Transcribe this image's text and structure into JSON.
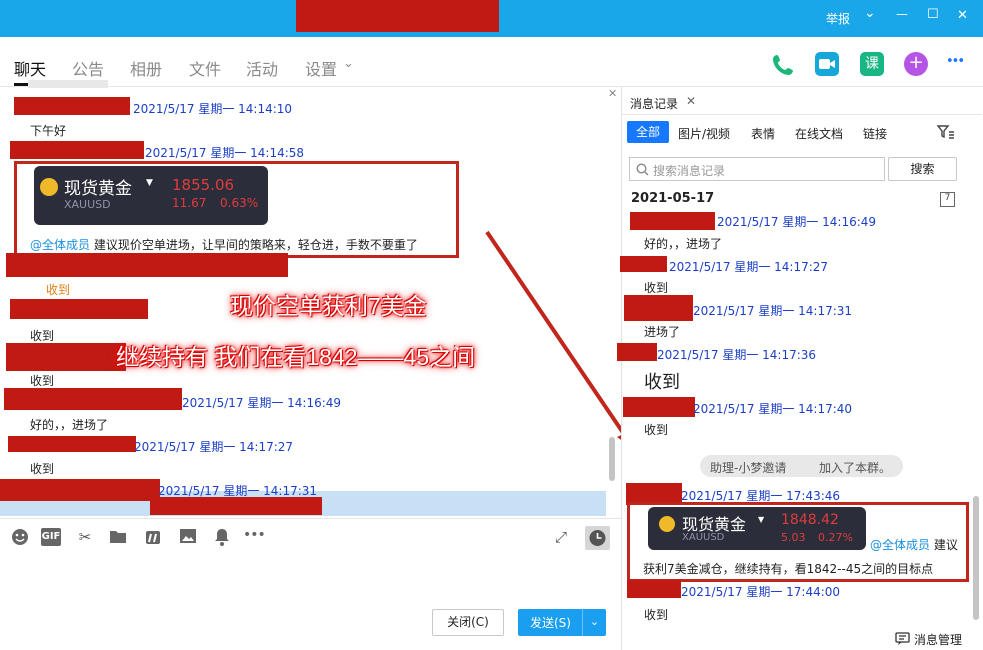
{
  "window": {
    "controls": {
      "report": "举报",
      "dropdown": "⌄",
      "minimize": "—",
      "maximize": "☐",
      "close": "✕"
    }
  },
  "nav": {
    "tabs": [
      "聊天",
      "公告",
      "相册",
      "文件",
      "活动",
      "设置"
    ],
    "settings_caret": "⌄"
  },
  "header_icons": {
    "phone": "phone-icon",
    "video": "video-icon",
    "course": "课",
    "add": "+",
    "more": "•••"
  },
  "chat": {
    "messages": [
      {
        "time": "2021/5/17 星期一 14:14:10",
        "text": "下午好"
      },
      {
        "time": "2021/5/17 星期一 14:14:58"
      },
      {
        "mention": "@全体成员",
        "text": " 建议现价空单进场，让早间的策略来，轻仓进，手数不要重了"
      },
      {
        "status": "收到"
      },
      {
        "text": "收到"
      },
      {
        "text": "收到"
      },
      {
        "time": "2021/5/17 星期一 14:16:49",
        "text": "好的，，进场了"
      },
      {
        "time": "2021/5/17 星期一 14:17:27",
        "text": "收到"
      },
      {
        "time": "2021/5/17 星期一 14:17:31"
      }
    ],
    "gold_card": {
      "name": "现货黄金",
      "symbol": "XAUUSD",
      "price": "1855.06",
      "change": "11.67",
      "percent": "0.63%"
    },
    "close_x": "✕",
    "overlay": {
      "line1": "现价空单获利7美金",
      "line2": "继续持有 我们在看1842——45之间"
    }
  },
  "toolbar": {
    "icons": [
      "smile-icon",
      "gif-icon",
      "scissors-icon",
      "folder-icon",
      "voice-icon",
      "image-icon",
      "bell-icon",
      "more-icon"
    ],
    "gif_label": "GIF"
  },
  "footer": {
    "close_label": "关闭(C)",
    "send_label": "发送(S)"
  },
  "history": {
    "title": "消息记录",
    "filters": [
      "全部",
      "图片/视频",
      "表情",
      "在线文档",
      "链接"
    ],
    "search_placeholder": "搜索消息记录",
    "search_button": "搜索",
    "date": "2021-05-17",
    "entries": [
      {
        "time": "2021/5/17 星期一 14:16:49",
        "text": "好的，，进场了"
      },
      {
        "time": "2021/5/17 星期一 14:17:27",
        "text": "收到"
      },
      {
        "time": "2021/5/17 星期一 14:17:31",
        "text": "进场了"
      },
      {
        "time": "2021/5/17 星期一 14:17:36",
        "text": "收到"
      },
      {
        "time": "2021/5/17 星期一 14:17:40",
        "text": "收到"
      },
      {
        "time": "2021/5/17 星期一 17:43:46"
      },
      {
        "time": "2021/5/17 星期一 17:44:00",
        "text": "收到"
      }
    ],
    "system_notice": {
      "invitee": "助理-小梦邀请",
      "action": "加入了本群。"
    },
    "gold_card": {
      "name": "现货黄金",
      "symbol": "XAUUSD",
      "price": "1848.42",
      "change": "5.03",
      "percent": "0.27%"
    },
    "mention": "@全体成员",
    "mention_tail": " 建议",
    "card_message": "获利7美金减仓，继续持有，看1842--45之间的目标点",
    "manage_label": "消息管理"
  },
  "colors": {
    "titlebar": "#1aa7ea",
    "accent": "#1677ff",
    "timestamp": "#1a3fc9",
    "mention": "#1a8fe0",
    "frame": "#c0261c",
    "redaction": "#c01a12"
  }
}
